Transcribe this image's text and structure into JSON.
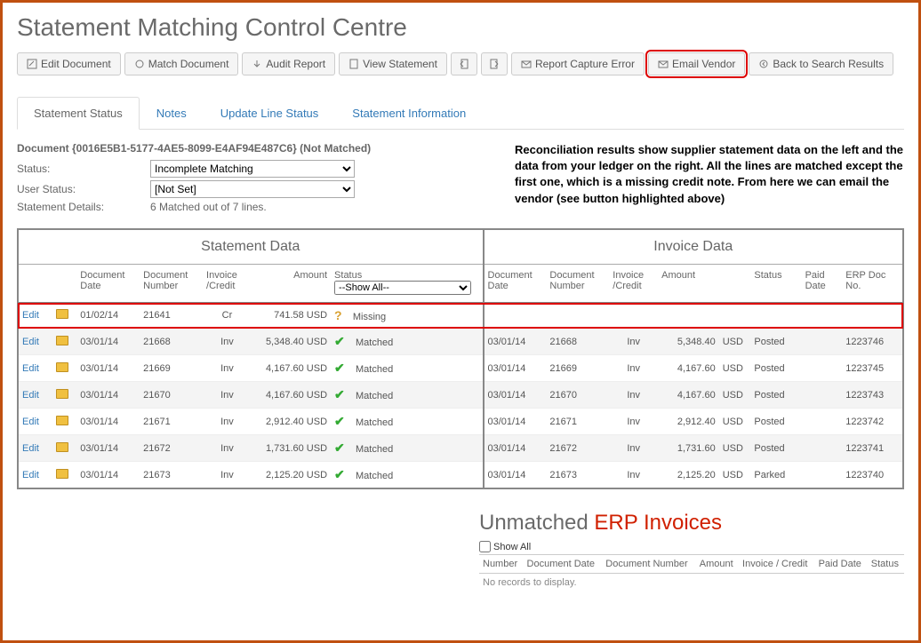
{
  "page_title": "Statement Matching Control Centre",
  "toolbar": {
    "edit_document": "Edit Document",
    "match_document": "Match Document",
    "audit_report": "Audit Report",
    "view_statement": "View Statement",
    "report_capture_error": "Report Capture Error",
    "email_vendor": "Email Vendor",
    "back_to_search": "Back to Search Results"
  },
  "tabs": {
    "statement_status": "Statement Status",
    "notes": "Notes",
    "update_line_status": "Update Line Status",
    "statement_information": "Statement Information"
  },
  "document": {
    "title": "Document {0016E5B1-5177-4AE5-8099-E4AF94E487C6}   (Not Matched)",
    "status_label": "Status:",
    "status_value": "Incomplete Matching",
    "user_status_label": "User Status:",
    "user_status_value": "[Not Set]",
    "details_label": "Statement Details:",
    "details_value": "6 Matched out of 7 lines."
  },
  "explainer": "Reconciliation results show supplier statement data on the left and the data from your ledger on the right. All the lines are matched except the first one, which is a missing credit note. From here we can email the vendor (see button highlighted above)",
  "sections": {
    "statement_data": "Statement Data",
    "invoice_data": "Invoice Data"
  },
  "columns": {
    "edit": "Edit",
    "doc_date": "Document Date",
    "doc_number": "Document Number",
    "invoice_credit": "Invoice /Credit",
    "amount": "Amount",
    "status": "Status",
    "status_filter": "--Show All--",
    "paid_date": "Paid Date",
    "erp_doc_no": "ERP Doc No."
  },
  "rows": [
    {
      "edit": "Edit",
      "date": "01/02/14",
      "num": "21641",
      "ic": "Cr",
      "amount": "741.58 USD",
      "status": "Missing",
      "status_icon": "question",
      "inv_date": "",
      "inv_num": "",
      "inv_ic": "",
      "inv_amount": "",
      "inv_cur": "",
      "inv_status": "",
      "erp": "",
      "highlight": true
    },
    {
      "edit": "Edit",
      "date": "03/01/14",
      "num": "21668",
      "ic": "Inv",
      "amount": "5,348.40 USD",
      "status": "Matched",
      "status_icon": "check",
      "inv_date": "03/01/14",
      "inv_num": "21668",
      "inv_ic": "Inv",
      "inv_amount": "5,348.40",
      "inv_cur": "USD",
      "inv_status": "Posted",
      "erp": "1223746"
    },
    {
      "edit": "Edit",
      "date": "03/01/14",
      "num": "21669",
      "ic": "Inv",
      "amount": "4,167.60 USD",
      "status": "Matched",
      "status_icon": "check",
      "inv_date": "03/01/14",
      "inv_num": "21669",
      "inv_ic": "Inv",
      "inv_amount": "4,167.60",
      "inv_cur": "USD",
      "inv_status": "Posted",
      "erp": "1223745"
    },
    {
      "edit": "Edit",
      "date": "03/01/14",
      "num": "21670",
      "ic": "Inv",
      "amount": "4,167.60 USD",
      "status": "Matched",
      "status_icon": "check",
      "inv_date": "03/01/14",
      "inv_num": "21670",
      "inv_ic": "Inv",
      "inv_amount": "4,167.60",
      "inv_cur": "USD",
      "inv_status": "Posted",
      "erp": "1223743"
    },
    {
      "edit": "Edit",
      "date": "03/01/14",
      "num": "21671",
      "ic": "Inv",
      "amount": "2,912.40 USD",
      "status": "Matched",
      "status_icon": "check",
      "inv_date": "03/01/14",
      "inv_num": "21671",
      "inv_ic": "Inv",
      "inv_amount": "2,912.40",
      "inv_cur": "USD",
      "inv_status": "Posted",
      "erp": "1223742"
    },
    {
      "edit": "Edit",
      "date": "03/01/14",
      "num": "21672",
      "ic": "Inv",
      "amount": "1,731.60 USD",
      "status": "Matched",
      "status_icon": "check",
      "inv_date": "03/01/14",
      "inv_num": "21672",
      "inv_ic": "Inv",
      "inv_amount": "1,731.60",
      "inv_cur": "USD",
      "inv_status": "Posted",
      "erp": "1223741"
    },
    {
      "edit": "Edit",
      "date": "03/01/14",
      "num": "21673",
      "ic": "Inv",
      "amount": "2,125.20 USD",
      "status": "Matched",
      "status_icon": "check",
      "inv_date": "03/01/14",
      "inv_num": "21673",
      "inv_ic": "Inv",
      "inv_amount": "2,125.20",
      "inv_cur": "USD",
      "inv_status": "Parked",
      "erp": "1223740"
    }
  ],
  "unmatched": {
    "title_a": "Unmatched ",
    "title_b": "ERP Invoices",
    "show_all": "Show All",
    "cols": {
      "number": "Number",
      "doc_date": "Document Date",
      "doc_number": "Document Number",
      "amount": "Amount",
      "invoice_credit": "Invoice / Credit",
      "paid_date": "Paid Date",
      "status": "Status"
    },
    "empty": "No records to display."
  }
}
